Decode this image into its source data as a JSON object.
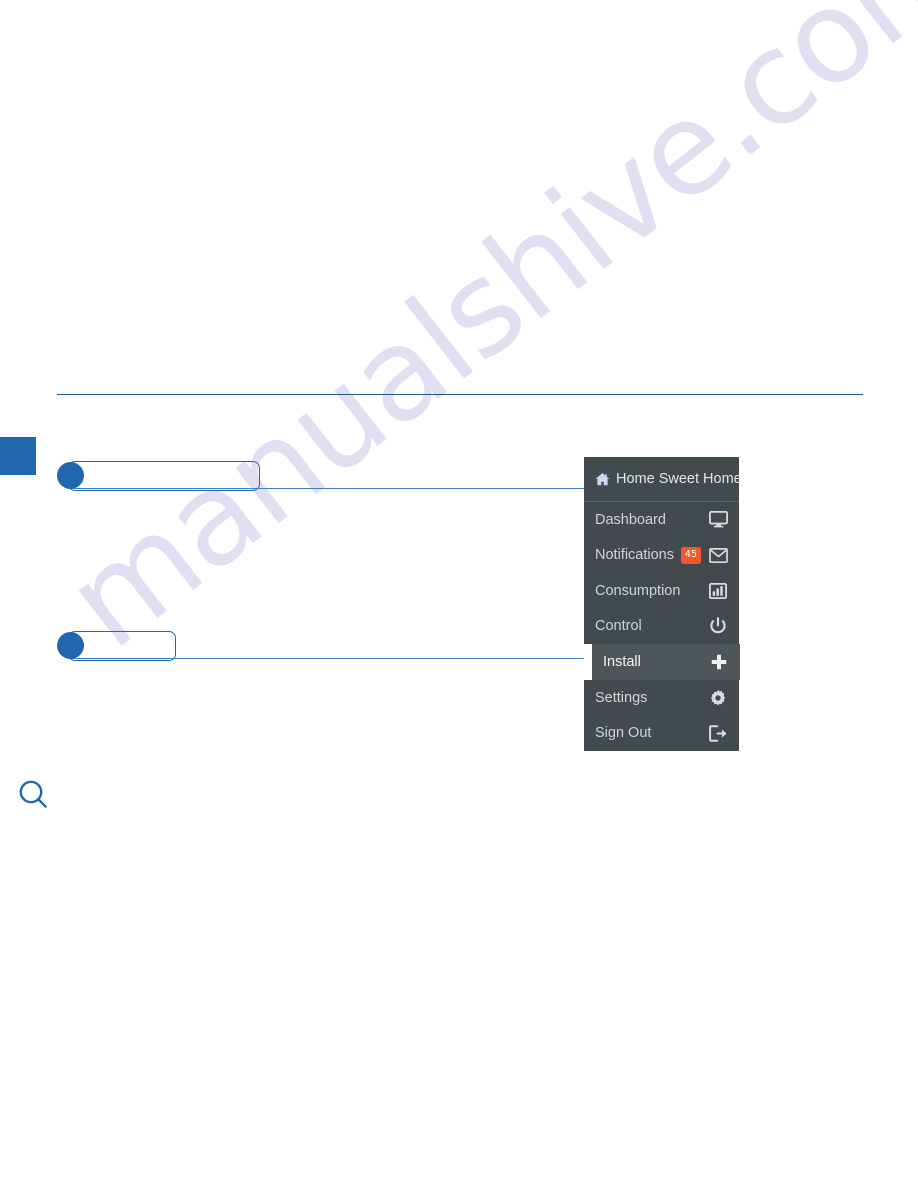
{
  "page": {
    "watermark_text": "manualshive.com",
    "accent_blue": "#2167ae",
    "rule_color": "#1c5d7d",
    "menu_bg": "#434a4e",
    "menu_active_bg": "#4f565a",
    "badge_color": "#f05a2b"
  },
  "icons": {
    "search": "search-icon",
    "home": "home-icon",
    "dashboard": "monitor-icon",
    "notifications": "envelope-icon",
    "consumption": "bar-chart-icon",
    "control": "power-icon",
    "install": "plus-icon",
    "settings": "gear-icon",
    "signout": "sign-out-icon"
  },
  "menu": {
    "header": {
      "label": "Home Sweet Home",
      "icon": "home-icon"
    },
    "items": [
      {
        "label": "Dashboard",
        "icon": "monitor-icon",
        "badge": "",
        "active": false
      },
      {
        "label": "Notifications",
        "icon": "envelope-icon",
        "badge": "45",
        "active": false
      },
      {
        "label": "Consumption",
        "icon": "bar-chart-icon",
        "badge": "",
        "active": false
      },
      {
        "label": "Control",
        "icon": "power-icon",
        "badge": "",
        "active": false
      },
      {
        "label": "Install",
        "icon": "plus-icon",
        "badge": "",
        "active": true
      },
      {
        "label": "Settings",
        "icon": "gear-icon",
        "badge": "",
        "active": false
      },
      {
        "label": "Sign Out",
        "icon": "sign-out-icon",
        "badge": "",
        "active": false
      }
    ]
  },
  "callouts": [
    {
      "id": "1",
      "marker": "",
      "target": "Home Sweet Home"
    },
    {
      "id": "2",
      "marker": "",
      "target": "Install"
    }
  ]
}
